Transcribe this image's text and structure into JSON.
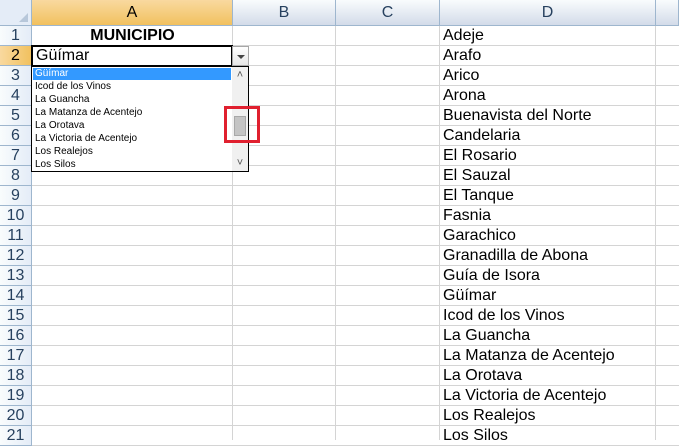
{
  "columns": [
    "A",
    "B",
    "C",
    "D"
  ],
  "rows": [
    "1",
    "2",
    "3",
    "4",
    "5",
    "6",
    "7",
    "8",
    "9",
    "10",
    "11",
    "12",
    "13",
    "14",
    "15",
    "16",
    "17",
    "18",
    "19",
    "20",
    "21"
  ],
  "cell_a1": "MUNICIPIO",
  "active_cell": {
    "address": "A2",
    "value": "Güímar"
  },
  "dropdown_items": [
    "Güímar",
    "Icod de los Vinos",
    "La Guancha",
    "La Matanza de Acentejo",
    "La Orotava",
    "La Victoria de Acentejo",
    "Los Realejos",
    "Los Silos"
  ],
  "dropdown_selected_index": 0,
  "scrollbar": {
    "up_glyph": "˄",
    "down_glyph": "˅"
  },
  "column_d": [
    "Adeje",
    "Arafo",
    "Arico",
    "Arona",
    "Buenavista del Norte",
    "Candelaria",
    "El Rosario",
    "El Sauzal",
    "El Tanque",
    "Fasnia",
    "Garachico",
    "Granadilla de Abona",
    "Guía de Isora",
    "Güímar",
    "Icod de los Vinos",
    "La Guancha",
    "La Matanza de Acentejo",
    "La Orotava",
    "La Victoria de Acentejo",
    "Los Realejos",
    "Los Silos"
  ],
  "colors": {
    "selection": "#3399ff",
    "highlight_box": "#e0202f",
    "header_active": "#f1c15f",
    "gridline": "#d4d4d4"
  },
  "icons": {
    "dropdown_arrow": "chevron-down-icon",
    "scroll_up": "scroll-up-icon",
    "scroll_down": "scroll-down-icon"
  }
}
